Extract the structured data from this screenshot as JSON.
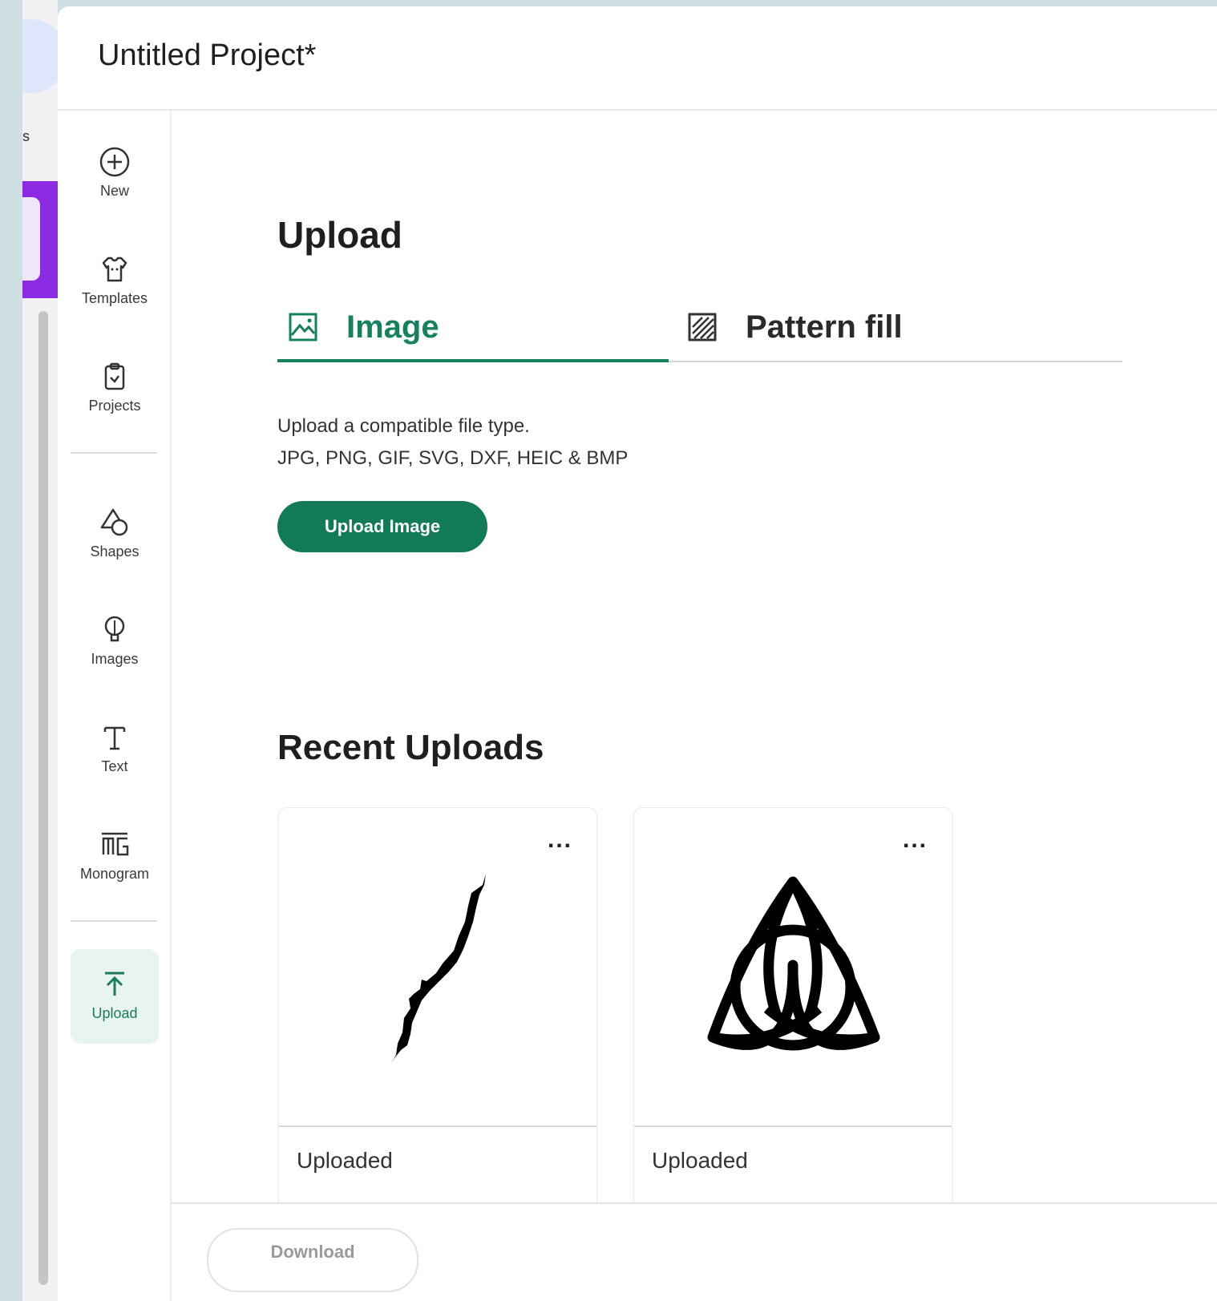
{
  "window": {
    "title": "Untitled Project*"
  },
  "left_strip": {
    "fragment_text": "s"
  },
  "rail": {
    "items": [
      {
        "label": "New",
        "icon": "plus-circle-icon"
      },
      {
        "label": "Templates",
        "icon": "tshirt-icon"
      },
      {
        "label": "Projects",
        "icon": "clipboard-icon"
      },
      {
        "label": "Shapes",
        "icon": "shapes-icon"
      },
      {
        "label": "Images",
        "icon": "lightbulb-icon"
      },
      {
        "label": "Text",
        "icon": "text-icon"
      },
      {
        "label": "Monogram",
        "icon": "monogram-icon"
      },
      {
        "label": "Upload",
        "icon": "upload-icon",
        "active": true
      }
    ]
  },
  "upload_panel": {
    "heading": "Upload",
    "tabs": [
      {
        "label": "Image",
        "icon": "image-icon",
        "selected": true
      },
      {
        "label": "Pattern fill",
        "icon": "pattern-fill-icon",
        "selected": false
      }
    ],
    "description_line1": "Upload a compatible file type.",
    "description_line2": "JPG, PNG, GIF, SVG, DXF, HEIC & BMP",
    "upload_button": "Upload Image"
  },
  "recent": {
    "heading": "Recent Uploads",
    "cards": [
      {
        "caption": "Uploaded",
        "thumbnail": "lake-silhouette",
        "menu": "..."
      },
      {
        "caption": "Uploaded",
        "thumbnail": "triquetra-knot",
        "menu": "..."
      }
    ]
  },
  "footer": {
    "download_button": "Download"
  },
  "colors": {
    "accent": "#137a58",
    "active_bg": "#e8f4ef",
    "sidebar_purple": "#8a2be2",
    "background": "#cfe0e4"
  }
}
